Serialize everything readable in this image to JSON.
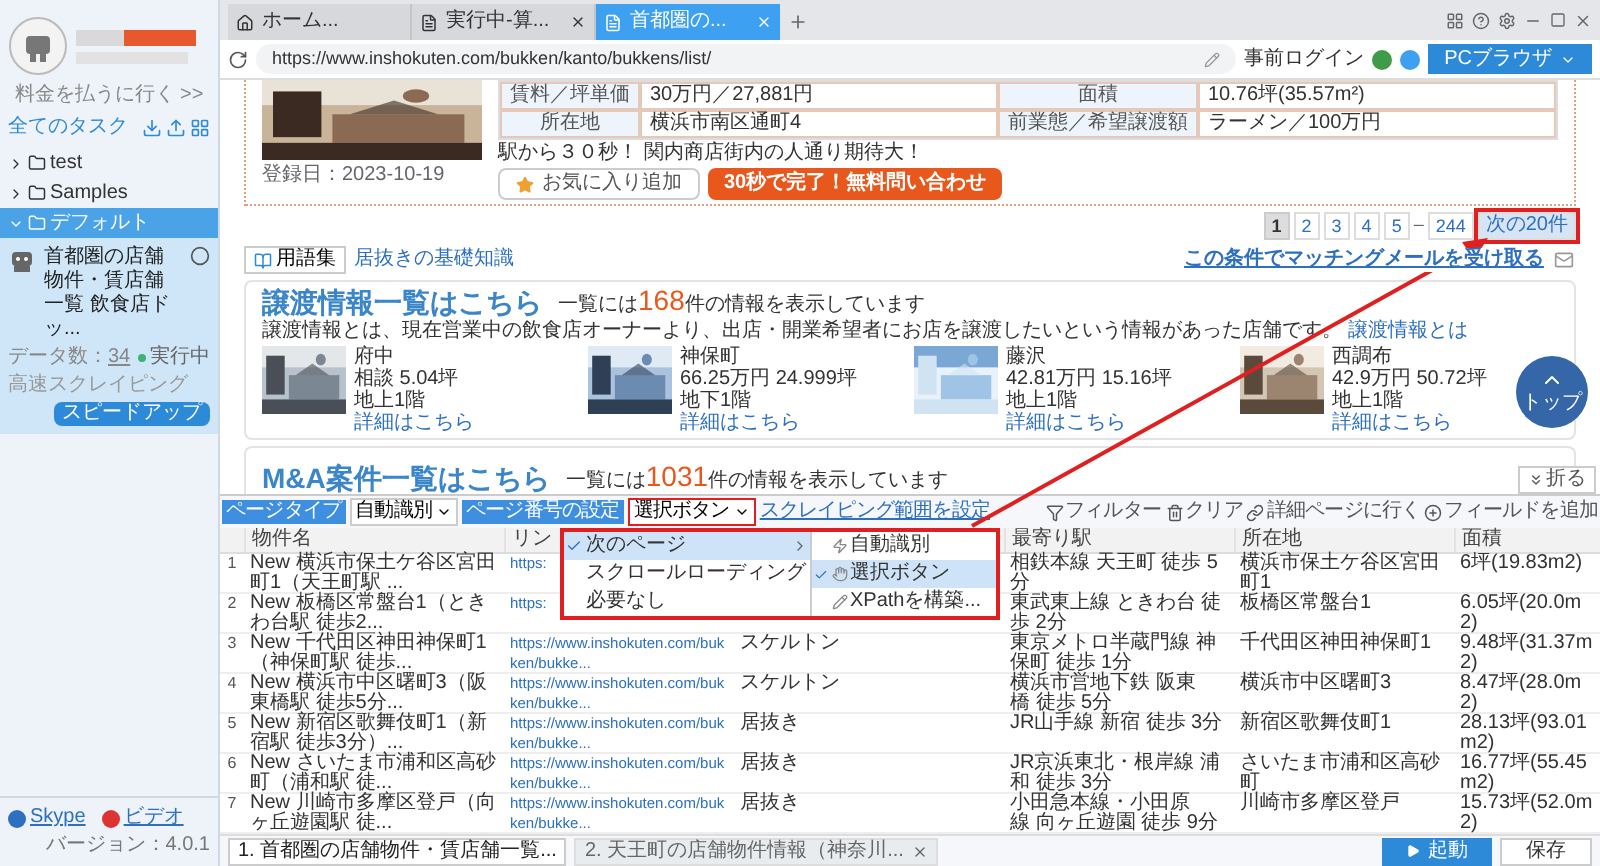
{
  "sidebar": {
    "upgrade_link": "料金を払うに行く >>",
    "all_tasks": "全てのタスク",
    "folders": [
      {
        "label": "test",
        "expanded": false,
        "selected": false
      },
      {
        "label": "Samples",
        "expanded": false,
        "selected": false
      },
      {
        "label": "デフォルト",
        "expanded": true,
        "selected": true,
        "children": [
          {
            "title": "首都圏の店舗物件・賃店舗一覧 飲食店ドッ...",
            "count_label": "データ数：",
            "count": "34",
            "status": "実行中",
            "mode": "高速スクレイピング",
            "action": "スピードアップ"
          }
        ]
      }
    ],
    "footer": {
      "links": [
        "Skype",
        "ビデオ"
      ],
      "version": "バージョン：4.0.1"
    }
  },
  "browser": {
    "tabs": [
      {
        "label": "ホーム...",
        "selected": false,
        "kind": "home",
        "closable": false
      },
      {
        "label": "実行中-算...",
        "selected": false,
        "kind": "page",
        "closable": true
      },
      {
        "label": "首都圏の...",
        "selected": true,
        "kind": "page",
        "closable": true
      }
    ],
    "url": "https://www.inshokuten.com/bukken/kanto/bukkens/list/",
    "login": "事前ログイン",
    "mode": "PCブラウザ"
  },
  "page": {
    "listing": {
      "cells": [
        [
          "賃料／坪単価",
          "30万円／27,881円",
          "面積",
          "10.76坪(35.57m²)"
        ],
        [
          "所在地",
          "横浜市南区通町4",
          "前業態／希望譲渡額",
          "ラーメン／100万円"
        ]
      ],
      "date": "登録日：2023-10-19",
      "tagline": "駅から３０秒！ 関内商店街内の人通り期待大！",
      "favorite": "お気に入り追加",
      "inquiry": "30秒で完了！無料問い合わせ"
    },
    "pagination": [
      {
        "label": "1",
        "kind": "page",
        "selected": true
      },
      {
        "label": "2",
        "kind": "page",
        "selected": false
      },
      {
        "label": "3",
        "kind": "page",
        "selected": false
      },
      {
        "label": "4",
        "kind": "page",
        "selected": false
      },
      {
        "label": "5",
        "kind": "page",
        "selected": false
      },
      {
        "label": "–",
        "kind": "gap"
      },
      {
        "label": "244",
        "kind": "page",
        "selected": false
      },
      {
        "label": "次の20件",
        "kind": "next",
        "selected": false,
        "highlighted": true
      }
    ],
    "glossary": "用語集",
    "glossary_link": "居抜きの基礎知識",
    "mail_link": "この条件でマッチングメールを受け取る",
    "transfer": {
      "title": "譲渡情報一覧はこちら",
      "count_prefix": "一覧には",
      "count": "168",
      "count_suffix": "件の情報を表示しています",
      "description": "譲渡情報とは、現在営業中の飲食店オーナーより、出店・開業希望者にお店を譲渡したいという情報があった店舗です。",
      "description_link": "譲渡情報とは",
      "items": [
        {
          "place": "府中",
          "price": "相談",
          "area": "5.04坪",
          "floor": "地上1階",
          "link": "詳細はこちら"
        },
        {
          "place": "神保町",
          "price": "66.25万円",
          "area": "24.999坪",
          "floor": "地下1階",
          "link": "詳細はこちら"
        },
        {
          "place": "藤沢",
          "price": "42.81万円",
          "area": "15.16坪",
          "floor": "地上1階",
          "link": "詳細はこちら"
        },
        {
          "place": "西調布",
          "price": "42.9万円",
          "area": "50.72坪",
          "floor": "地上1階",
          "link": "詳細はこちら"
        }
      ]
    },
    "ma": {
      "title": "M&A案件一覧はこちら",
      "count_prefix": "一覧には",
      "count": "1031",
      "count_suffix": "件の情報を表示しています"
    },
    "top_button": "トップ",
    "collapse": "折る"
  },
  "toolbar": {
    "page_type_label": "ページタイプ",
    "page_type_value": "自動識別",
    "paging_label": "ページ番号の設定",
    "paging_value": "選択ボタン",
    "range_link": "スクレイピング範囲を設定",
    "actions": [
      {
        "kind": "filter",
        "label": "フィルター"
      },
      {
        "kind": "clear",
        "label": "クリア"
      },
      {
        "kind": "detail",
        "label": "詳細ページに行く"
      },
      {
        "kind": "add",
        "label": "フィールドを追加"
      }
    ]
  },
  "menu": {
    "options": [
      {
        "label": "次のページ",
        "selected": true,
        "has_submenu": true
      },
      {
        "label": "スクロールローディング",
        "selected": false,
        "has_submenu": false
      },
      {
        "label": "必要なし",
        "selected": false,
        "has_submenu": false
      }
    ],
    "submenu": [
      {
        "label": "自動識別",
        "selected": false
      },
      {
        "label": "選択ボタン",
        "selected": true
      },
      {
        "label": "XPathを構築...",
        "selected": false
      }
    ]
  },
  "table": {
    "columns": {
      "name": "物件名",
      "link": "リン",
      "station": "最寄り駅",
      "address": "所在地",
      "area": "面積"
    },
    "rows": [
      {
        "no": "1",
        "name": "New 横浜市保土ケ谷区宮田町1（天王町駅 ...",
        "link": "https:",
        "station": "相鉄本線 天王町 徒歩 5分",
        "address": "横浜市保土ケ谷区宮田町1",
        "area": "6坪(19.83m2)"
      },
      {
        "no": "2",
        "name": "New 板橋区常盤台1（ときわ台駅 徒歩2...",
        "link": "https:",
        "station": "東武東上線 ときわ台 徒歩 2分",
        "address": "板橋区常盤台1",
        "area": "6.05坪(20.0m2)"
      },
      {
        "no": "3",
        "name": "New 千代田区神田神保町1（神保町駅 徒歩...",
        "link": "https://www.inshokuten.com/bukken/bukke...",
        "type": "スケルトン",
        "station": "東京メトロ半蔵門線 神保町 徒歩 1分",
        "address": "千代田区神田神保町1",
        "area": "9.48坪(31.37m2)"
      },
      {
        "no": "4",
        "name": "New 横浜市中区曙町3（阪東橋駅 徒歩5分...",
        "link": "https://www.inshokuten.com/bukken/bukke...",
        "type": "スケルトン",
        "station": "横浜市営地下鉄 阪東橋 徒歩 5分",
        "address": "横浜市中区曙町3",
        "area": "8.47坪(28.0m2)"
      },
      {
        "no": "5",
        "name": "New 新宿区歌舞伎町1（新宿駅 徒歩3分）...",
        "link": "https://www.inshokuten.com/bukken/bukke...",
        "type": "居抜き",
        "station": "JR山手線 新宿 徒歩 3分",
        "address": "新宿区歌舞伎町1",
        "area": "28.13坪(93.01m2)"
      },
      {
        "no": "6",
        "name": "New さいたま市浦和区高砂町（浦和駅 徒...",
        "link": "https://www.inshokuten.com/bukken/bukke...",
        "type": "居抜き",
        "station": "JR京浜東北・根岸線 浦和 徒歩 3分",
        "address": "さいたま市浦和区高砂町",
        "area": "16.77坪(55.45m2)"
      },
      {
        "no": "7",
        "name": "New 川崎市多摩区登戸（向ヶ丘遊園駅 徒...",
        "link": "https://www.inshokuten.com/bukken/bukke...",
        "type": "居抜き",
        "station": "小田急本線・小田原線 向ヶ丘遊園 徒歩 9分",
        "address": "川崎市多摩区登戸",
        "area": "15.73坪(52.0m2)"
      }
    ]
  },
  "task_tabs": [
    {
      "label": "1. 首都圏の店舗物件・賃店舗一覧...",
      "selected": true,
      "closable": false
    },
    {
      "label": "2. 天王町の店舗物件情報（神奈川...",
      "selected": false,
      "closable": true
    }
  ],
  "buttons": {
    "start": "起動",
    "save": "保存"
  }
}
